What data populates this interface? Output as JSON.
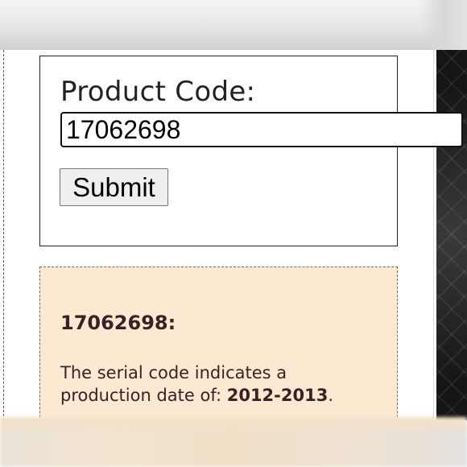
{
  "form": {
    "label": "Product Code:",
    "input_value": "17062698",
    "submit_label": "Submit"
  },
  "result": {
    "title": "17062698:",
    "text_prefix": "The serial code indicates a production date of: ",
    "date_range": "2012-2013",
    "text_suffix": "."
  },
  "colors": {
    "result_background": "#fde9d2",
    "result_text": "#3b2026",
    "side_texture": "#1f1f1f"
  }
}
